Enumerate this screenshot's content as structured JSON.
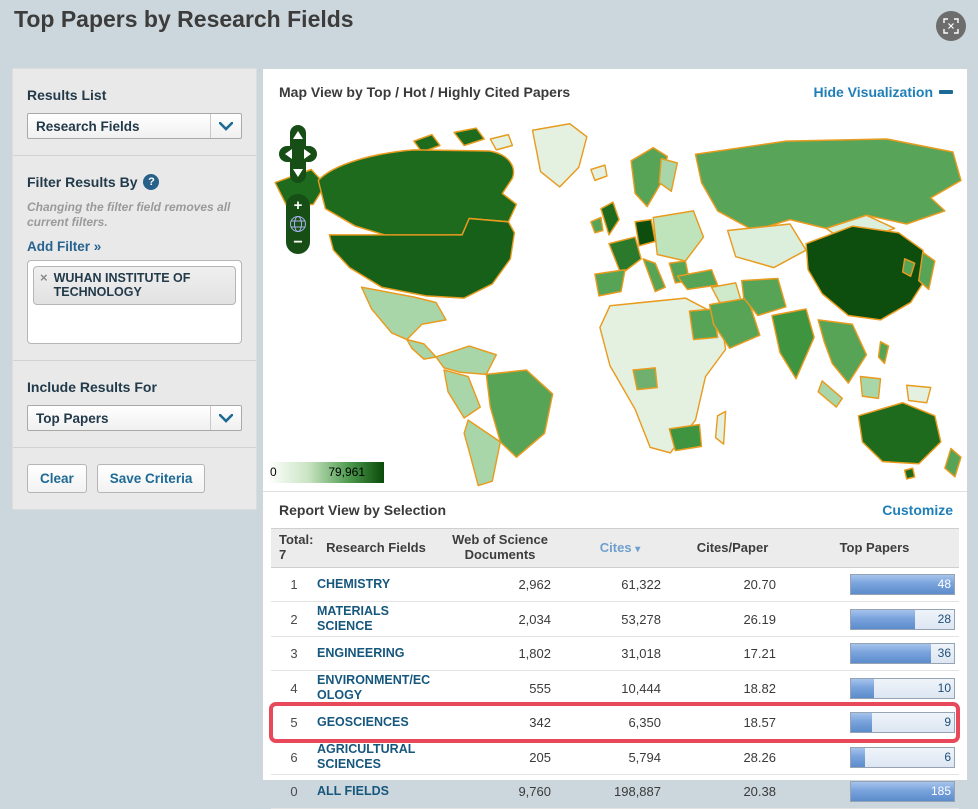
{
  "page": {
    "title": "Top Papers by Research Fields"
  },
  "sidebar": {
    "results_list": {
      "heading": "Results List",
      "selected": "Research Fields"
    },
    "filter": {
      "heading": "Filter Results By",
      "help_icon": "?",
      "note": "Changing the filter field removes all current filters.",
      "add_filter": "Add Filter »",
      "tag": {
        "remove": "×",
        "label": "WUHAN INSTITUTE OF TECHNOLOGY"
      }
    },
    "include_results": {
      "heading": "Include Results For",
      "selected": "Top Papers"
    },
    "actions": {
      "clear": "Clear",
      "save": "Save Criteria"
    }
  },
  "map": {
    "title": "Map View by Top / Hot / Highly Cited Papers",
    "hide_link": "Hide Visualization",
    "legend": {
      "min": "0",
      "max": "79,961"
    },
    "controls": {
      "zoom_in": "+",
      "zoom_out": "−"
    }
  },
  "report": {
    "title": "Report View by Selection",
    "customize_link": "Customize",
    "columns": {
      "total": "Total: 7",
      "field": "Research Fields",
      "documents": "Web of Science Documents",
      "cites": "Cites",
      "cites_per_paper": "Cites/Paper",
      "top_papers": "Top Papers"
    },
    "sort_indicator": "▾",
    "rows": [
      {
        "rank": "1",
        "field": "CHEMISTRY",
        "documents": "2,962",
        "cites": "61,322",
        "cites_per_paper": "20.70",
        "top_papers": "48",
        "bar_percent": 100
      },
      {
        "rank": "2",
        "field": "MATERIALS SCIENCE",
        "documents": "2,034",
        "cites": "53,278",
        "cites_per_paper": "26.19",
        "top_papers": "28",
        "bar_percent": 62
      },
      {
        "rank": "3",
        "field": "ENGINEERING",
        "documents": "1,802",
        "cites": "31,018",
        "cites_per_paper": "17.21",
        "top_papers": "36",
        "bar_percent": 78
      },
      {
        "rank": "4",
        "field": "ENVIRONMENT/ECOLOGY",
        "documents": "555",
        "cites": "10,444",
        "cites_per_paper": "18.82",
        "top_papers": "10",
        "bar_percent": 22
      },
      {
        "rank": "5",
        "field": "GEOSCIENCES",
        "documents": "342",
        "cites": "6,350",
        "cites_per_paper": "18.57",
        "top_papers": "9",
        "bar_percent": 20,
        "highlighted": true
      },
      {
        "rank": "6",
        "field": "AGRICULTURAL SCIENCES",
        "documents": "205",
        "cites": "5,794",
        "cites_per_paper": "28.26",
        "top_papers": "6",
        "bar_percent": 14
      },
      {
        "rank": "0",
        "field": "ALL FIELDS",
        "documents": "9,760",
        "cites": "198,887",
        "cites_per_paper": "20.38",
        "top_papers": "185",
        "bar_percent": 100
      }
    ]
  },
  "colors": {
    "page_background": "#ccd7dd",
    "link_blue": "#1e7fb8",
    "field_link_blue": "#16577e",
    "highlight_red": "#e8495a",
    "bar_fill_blue": "#5b8ccc",
    "map_border_orange": "#e89b1e",
    "map_green_darkest": "#0d4d0d",
    "map_green_dark": "#1e6b1e",
    "map_green_medium": "#57a457",
    "map_green_light": "#a9d6a9",
    "map_green_pale": "#e4f1e0",
    "control_green": "#164e16"
  }
}
